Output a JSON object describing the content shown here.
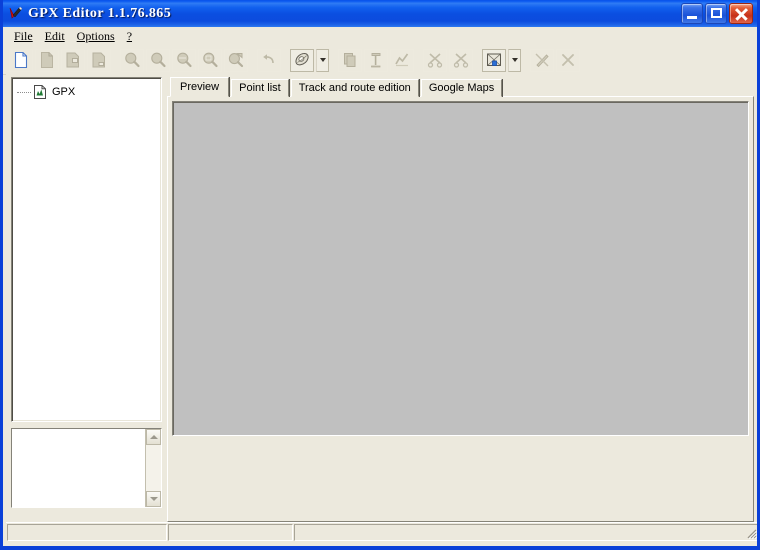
{
  "window": {
    "title": "GPX Editor 1.1.76.865",
    "icon": "gpx-editor-app-icon",
    "controls": {
      "minimize": "Minimize",
      "maximize": "Maximize",
      "close": "Close"
    },
    "colors": {
      "title_bar_blue": "#0C4CDE",
      "window_border": "#0A40D8",
      "face": "#ECE9DD",
      "preview_gray": "#C0C0C0",
      "close_red": "#C6301A"
    }
  },
  "menu": {
    "items": [
      {
        "label": "File",
        "accel": "F"
      },
      {
        "label": "Edit",
        "accel": "E"
      },
      {
        "label": "Options",
        "accel": "O"
      },
      {
        "label": "?",
        "accel": "?"
      }
    ]
  },
  "toolbar": {
    "buttons": [
      {
        "name": "new-file-button",
        "icon": "new-document-icon",
        "enabled": true,
        "framed": false
      },
      {
        "name": "open-file-button",
        "icon": "open-folder-icon",
        "enabled": false,
        "framed": false
      },
      {
        "name": "save-file-button",
        "icon": "save-disk-icon",
        "enabled": false,
        "framed": false
      },
      {
        "name": "save-as-button",
        "icon": "save-as-icon",
        "enabled": false,
        "framed": false
      },
      {
        "name": "zoom-in-button",
        "icon": "magnifier-plus-icon",
        "enabled": false,
        "framed": false
      },
      {
        "name": "zoom-out-button",
        "icon": "magnifier-minus-icon",
        "enabled": false,
        "framed": false
      },
      {
        "name": "zoom-fit-button",
        "icon": "magnifier-fit-icon",
        "enabled": false,
        "framed": false
      },
      {
        "name": "zoom-selection-button",
        "icon": "magnifier-select-icon",
        "enabled": false,
        "framed": false
      },
      {
        "name": "zoom-reset-button",
        "icon": "magnifier-reset-icon",
        "enabled": false,
        "framed": false
      },
      {
        "name": "undo-button",
        "icon": "undo-arrow-icon",
        "enabled": false,
        "framed": false
      },
      {
        "name": "globe-view-button",
        "icon": "globe-icon",
        "enabled": true,
        "framed": true
      },
      {
        "name": "copy-button",
        "icon": "copy-pages-icon",
        "enabled": false,
        "framed": false
      },
      {
        "name": "anchor-button",
        "icon": "anchor-icon",
        "enabled": false,
        "framed": false
      },
      {
        "name": "route-button",
        "icon": "route-icon",
        "enabled": false,
        "framed": false
      },
      {
        "name": "merge-tracks-button",
        "icon": "merge-tracks-icon",
        "enabled": false,
        "framed": false
      },
      {
        "name": "split-track-button",
        "icon": "split-track-icon",
        "enabled": false,
        "framed": false
      },
      {
        "name": "map-layer-button",
        "icon": "map-layer-icon",
        "enabled": true,
        "framed": true
      },
      {
        "name": "hide-track-button",
        "icon": "pen-strike-icon",
        "enabled": false,
        "framed": false
      },
      {
        "name": "delete-button",
        "icon": "delete-x-icon",
        "enabled": false,
        "framed": false
      }
    ],
    "dropdowns": {
      "globe_dropdown": "chevron-down-icon",
      "map_layer_dropdown": "chevron-down-icon"
    }
  },
  "tree": {
    "root": {
      "label": "GPX",
      "icon": "gpx-file-icon",
      "expanded": false
    }
  },
  "tabs": [
    {
      "label": "Preview",
      "active": true
    },
    {
      "label": "Point list",
      "active": false
    },
    {
      "label": "Track and route edition",
      "active": false
    },
    {
      "label": "Google Maps",
      "active": false
    }
  ],
  "preview": {
    "content": "",
    "background": "#C0C0C0"
  },
  "lower_panel": {
    "content": "",
    "scrollbar": {
      "up_arrow": "scroll-up-icon",
      "down_arrow": "scroll-down-icon"
    }
  },
  "status_bar": {
    "panel1": "",
    "panel2": "",
    "panel3": "",
    "grip": "resize-grip-icon"
  }
}
